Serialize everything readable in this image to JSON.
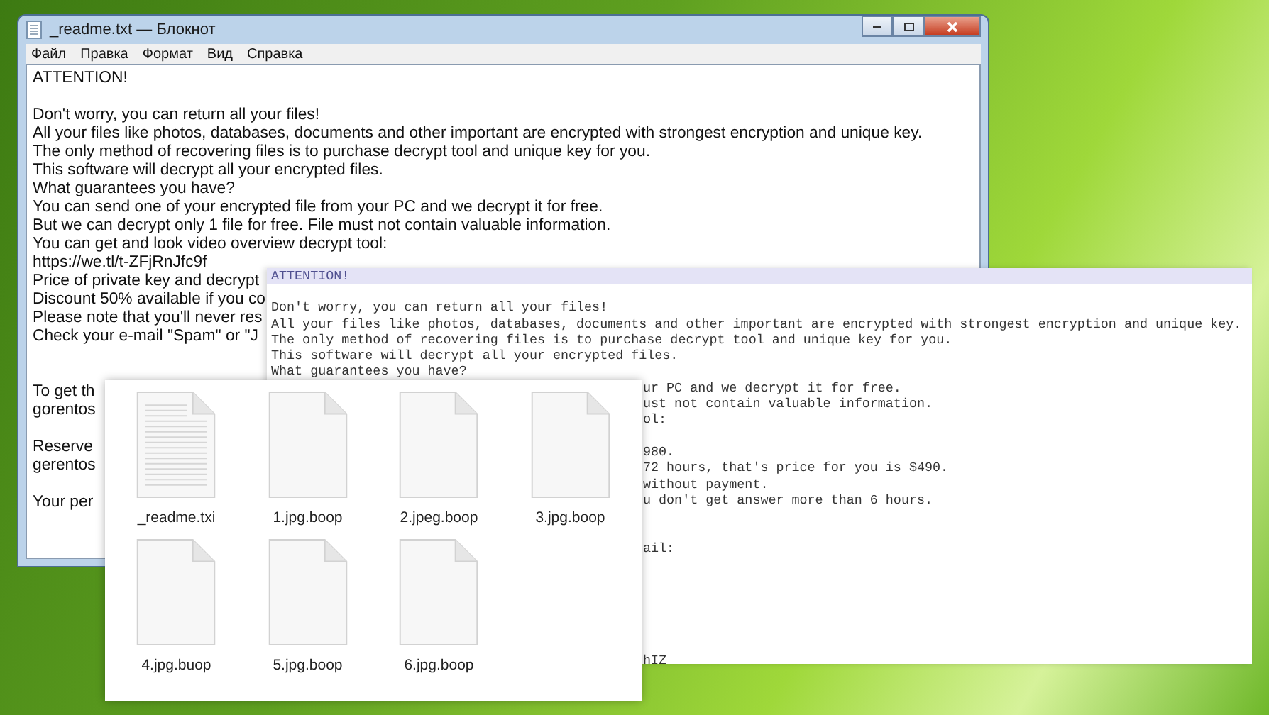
{
  "notepad": {
    "title": "_readme.txt — Блокнот",
    "menu": [
      "Файл",
      "Правка",
      "Формат",
      "Вид",
      "Справка"
    ],
    "lines": [
      {
        "kind": "text",
        "text": "ATTENTION!"
      },
      {
        "kind": "blank"
      },
      {
        "kind": "text",
        "text": "Don't worry, you can return all your files!"
      },
      {
        "kind": "text",
        "text": "All your files like photos, databases, documents and other important are encrypted with strongest encryption and unique key."
      },
      {
        "kind": "text",
        "text": "The only method of recovering files is to purchase decrypt tool and unique key for you."
      },
      {
        "kind": "text",
        "text": "This software will decrypt all your encrypted files."
      },
      {
        "kind": "text",
        "text": "What guarantees you have?"
      },
      {
        "kind": "text",
        "text": "You can send one of your encrypted file from your PC and we decrypt it for free."
      },
      {
        "kind": "text",
        "text": "But we can decrypt only 1 file for free. File must not contain valuable information."
      },
      {
        "kind": "text",
        "text": "You can get and look video overview decrypt tool:"
      },
      {
        "kind": "text",
        "text": "https://we.tl/t-ZFjRnJfc9f"
      },
      {
        "kind": "text",
        "text": "Price of private key and decrypt"
      },
      {
        "kind": "text",
        "text": "Discount 50% available if you co"
      },
      {
        "kind": "text",
        "text": "Please note that you'll never res"
      },
      {
        "kind": "text",
        "text": "Check your e-mail \"Spam\" or \"J"
      },
      {
        "kind": "blank"
      },
      {
        "kind": "blank"
      },
      {
        "kind": "text",
        "text": "To get th"
      },
      {
        "kind": "text",
        "text": "gorentos"
      },
      {
        "kind": "blank"
      },
      {
        "kind": "text",
        "text": "Reserve"
      },
      {
        "kind": "text",
        "text": "gerentos"
      },
      {
        "kind": "blank"
      },
      {
        "kind": "text",
        "text": "Your per"
      }
    ]
  },
  "note_overlay": {
    "lines": [
      {
        "kind": "header",
        "text": "ATTENTION!"
      },
      {
        "kind": "blank"
      },
      {
        "kind": "full",
        "text": "Don't worry, you can return all your files!"
      },
      {
        "kind": "full",
        "text": "All your files like photos, databases, documents and other important are encrypted with strongest encryption and unique key."
      },
      {
        "kind": "full",
        "text": "The only method of recovering files is to purchase decrypt tool and unique key for you."
      },
      {
        "kind": "full",
        "text": "This software will decrypt all your encrypted files."
      },
      {
        "kind": "full",
        "text": "What guarantees you have?"
      },
      {
        "kind": "clipped",
        "text": "ur PC and we decrypt it for free."
      },
      {
        "kind": "clipped",
        "text": "ust not contain valuable information."
      },
      {
        "kind": "clipped",
        "text": "ol:"
      },
      {
        "kind": "blank"
      },
      {
        "kind": "clipped",
        "text": "980."
      },
      {
        "kind": "clipped",
        "text": "72 hours, that's price for you is $490."
      },
      {
        "kind": "clipped",
        "text": "without payment."
      },
      {
        "kind": "clipped",
        "text": "u don't get answer more than 6 hours."
      },
      {
        "kind": "blank"
      },
      {
        "kind": "blank"
      },
      {
        "kind": "clipped",
        "text": "ail:"
      },
      {
        "kind": "blank"
      },
      {
        "kind": "blank"
      },
      {
        "kind": "blank"
      },
      {
        "kind": "blank"
      },
      {
        "kind": "blank"
      },
      {
        "kind": "blank"
      },
      {
        "kind": "clipped",
        "text": "hIZ"
      }
    ]
  },
  "files": [
    {
      "name": "_readme.txi",
      "kind": "text"
    },
    {
      "name": "1.jpg.boop",
      "kind": "blank"
    },
    {
      "name": "2.jpeg.boop",
      "kind": "blank"
    },
    {
      "name": "3.jpg.boop",
      "kind": "blank"
    },
    {
      "name": "4.jpg.buop",
      "kind": "blank"
    },
    {
      "name": "5.jpg.boop",
      "kind": "blank"
    },
    {
      "name": "6.jpg.boop",
      "kind": "blank"
    }
  ]
}
